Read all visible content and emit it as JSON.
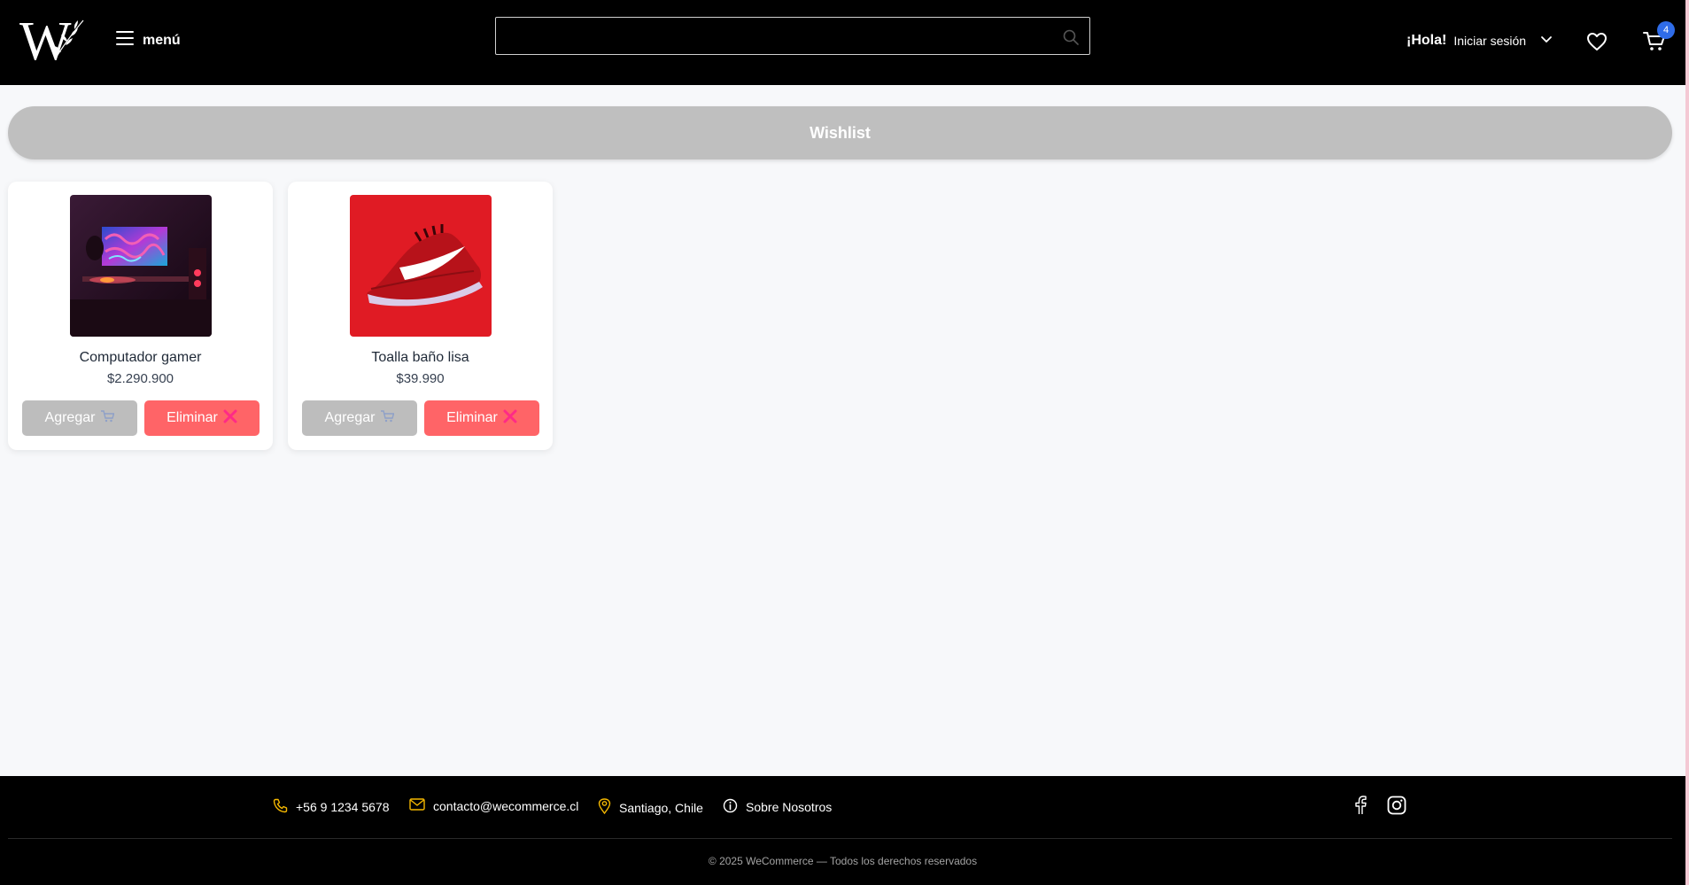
{
  "header": {
    "logo_text": "W",
    "menu_label": "menú",
    "search": {
      "placeholder": "",
      "value": ""
    },
    "greeting": "¡Hola!",
    "login_label": "Iniciar sesión",
    "cart_count": "4"
  },
  "wishlist": {
    "title": "Wishlist",
    "items": [
      {
        "name": "Computador gamer",
        "price": "$2.290.900",
        "add_label": "Agregar",
        "remove_label": "Eliminar"
      },
      {
        "name": "Toalla baño lisa",
        "price": "$39.990",
        "add_label": "Agregar",
        "remove_label": "Eliminar"
      }
    ]
  },
  "footer": {
    "phone": "+56 9 1234 5678",
    "email": "contacto@wecommerce.cl",
    "location": "Santiago, Chile",
    "about": "Sobre Nosotros",
    "copyright": "© 2025 WeCommerce — Todos los derechos reservados"
  },
  "colors": {
    "header_bg": "#000000",
    "wishlist_bar": "#bfbfbf",
    "add_button": "#bdbdbd",
    "remove_button": "#ff6467",
    "footer_icon": "#f5b800",
    "badge": "#2f6ce8"
  },
  "icons": [
    "hamburger-icon",
    "search-icon",
    "chevron-down-icon",
    "heart-icon",
    "cart-icon",
    "cart-emoji-icon",
    "cross-mark-icon",
    "phone-icon",
    "mail-icon",
    "location-pin-icon",
    "info-icon",
    "facebook-icon",
    "instagram-icon"
  ]
}
